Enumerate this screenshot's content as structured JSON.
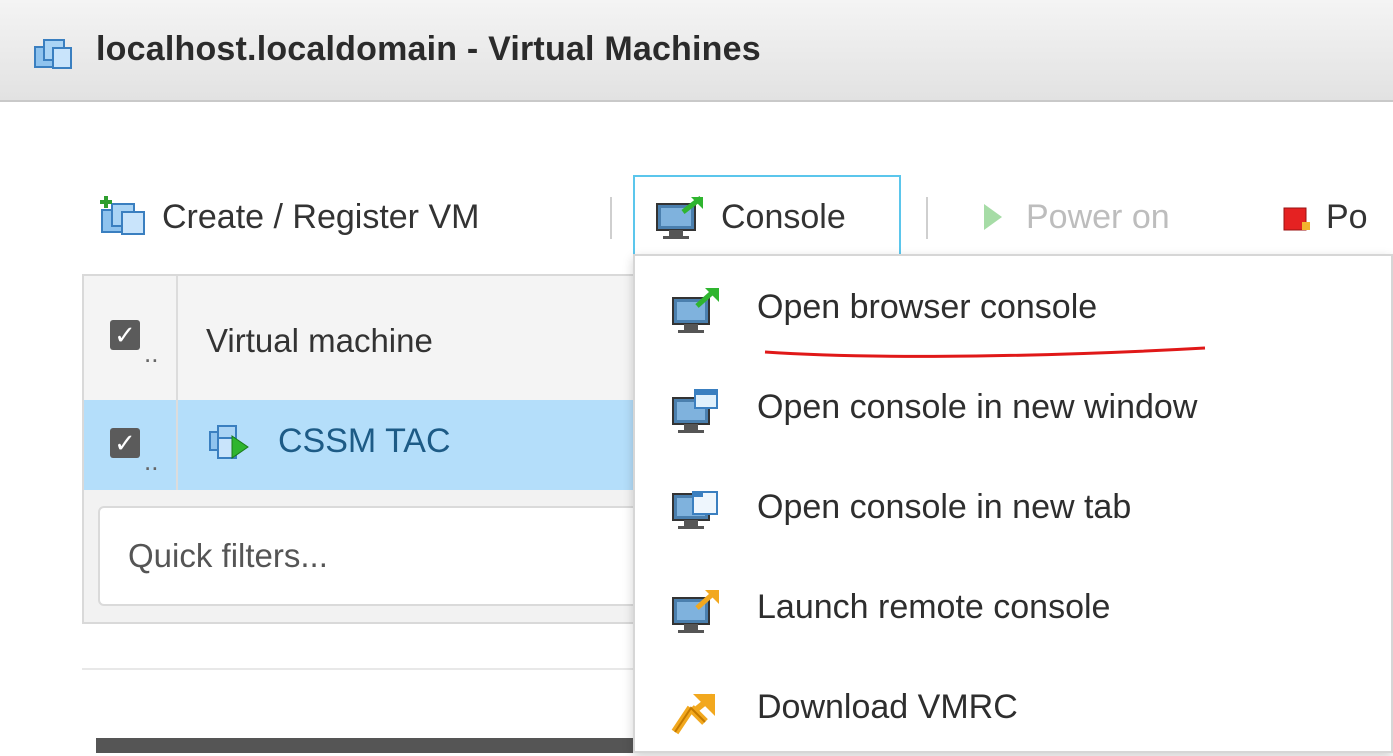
{
  "window": {
    "title": "localhost.localdomain - Virtual Machines",
    "icon": "vm-group-icon"
  },
  "toolbar": {
    "create_label": "Create / Register VM",
    "console_label": "Console",
    "power_on_label": "Power on",
    "power_off_label_partial": "Po"
  },
  "grid": {
    "header_label": "Virtual machine",
    "rows": [
      {
        "name": "CSSM TAC",
        "selected": true,
        "state": "powered-on"
      }
    ],
    "quick_filter_placeholder": "Quick filters..."
  },
  "console_menu": {
    "items": [
      {
        "label": "Open browser console",
        "icon": "browser-console-icon",
        "annotated": true
      },
      {
        "label": "Open console in new window",
        "icon": "console-window-icon"
      },
      {
        "label": "Open console in new tab",
        "icon": "console-tab-icon"
      },
      {
        "label": "Launch remote console",
        "icon": "remote-console-icon"
      },
      {
        "label": "Download VMRC",
        "icon": "vmrc-download-icon"
      }
    ]
  },
  "colors": {
    "selection": "#b4defa",
    "console_focus_border": "#5bc6ec",
    "annotation": "#e01818"
  }
}
